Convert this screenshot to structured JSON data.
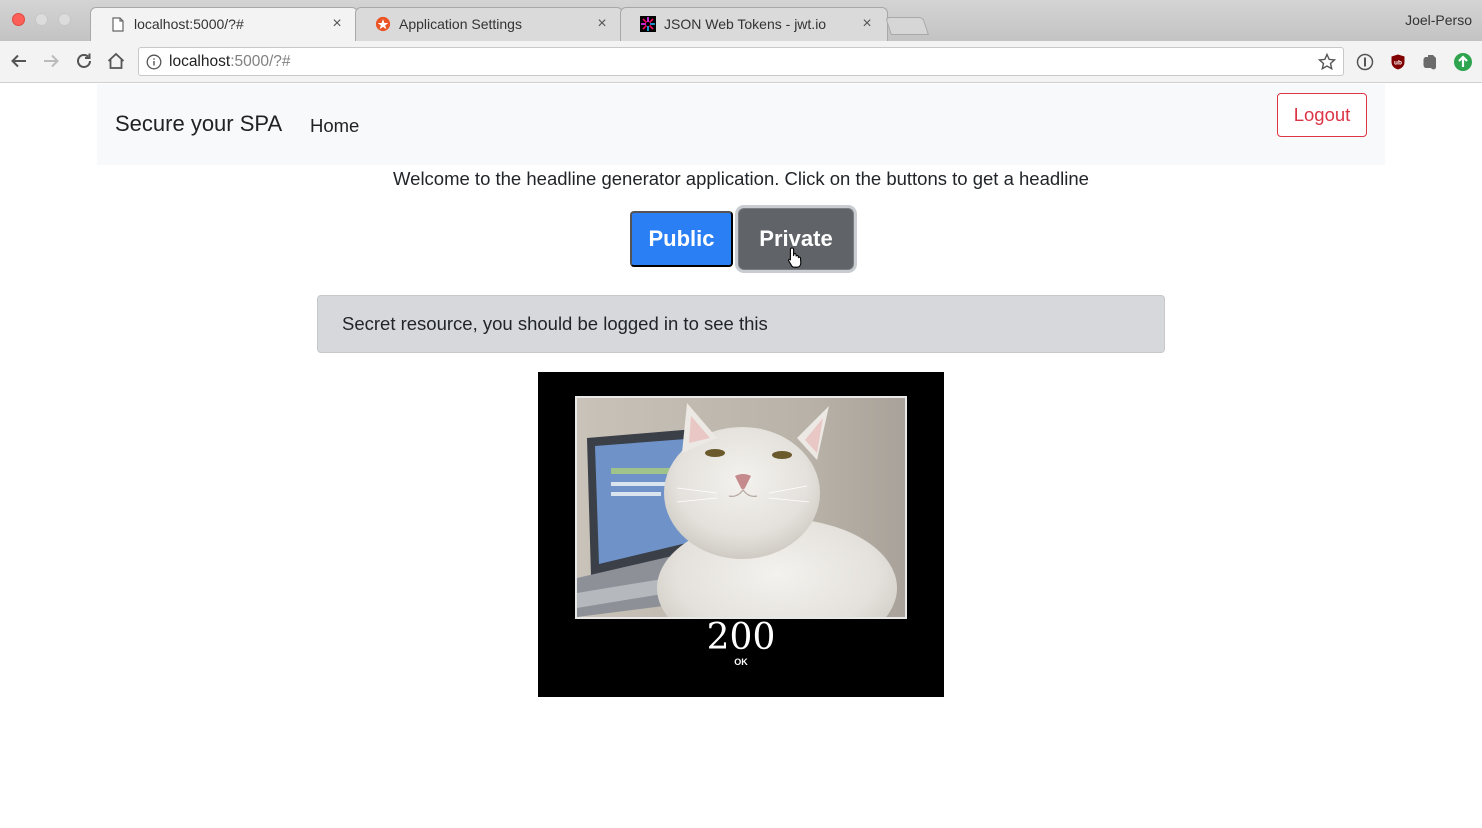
{
  "browser": {
    "tabs": [
      {
        "title": "localhost:5000/?#",
        "active": true,
        "favicon": "page-icon"
      },
      {
        "title": "Application Settings",
        "active": false,
        "favicon": "auth0-icon"
      },
      {
        "title": "JSON Web Tokens - jwt.io",
        "active": false,
        "favicon": "jwt-icon"
      }
    ],
    "profile_name": "Joel-Perso",
    "url_host": "localhost",
    "url_rest": ":5000/?#",
    "extensions": [
      "1password-icon",
      "ublock-icon",
      "evernote-icon",
      "green-extension-icon"
    ]
  },
  "page": {
    "brand": "Secure your SPA",
    "nav_home": "Home",
    "logout_label": "Logout",
    "welcome_text": "Welcome to the headline generator application. Click on the buttons to get a headline",
    "public_label": "Public",
    "private_label": "Private",
    "secret_text": "Secret resource, you should be logged in to see this",
    "meme": {
      "status_code": "200",
      "status_text": "OK"
    }
  },
  "colors": {
    "public_button": "#2a7ff5",
    "private_button": "#606468",
    "logout_border": "#dc3545",
    "navbar_bg": "#f8f9fa",
    "alert_bg": "#d6d8db"
  }
}
